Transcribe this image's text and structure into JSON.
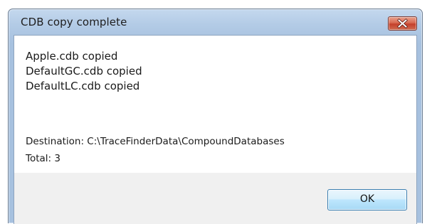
{
  "window": {
    "title": "CDB copy complete",
    "close_icon": "close-icon",
    "colors": {
      "frame": "#b3cbe6",
      "close_button": "#c4402b",
      "ok_button_border": "#3c7fb1"
    }
  },
  "message": {
    "copied_files": [
      "Apple.cdb copied",
      "DefaultGC.cdb copied",
      "DefaultLC.cdb copied"
    ],
    "destination": "Destination: C:\\TraceFinderData\\CompoundDatabases",
    "total": "Total: 3"
  },
  "buttons": {
    "ok_label": "OK"
  }
}
